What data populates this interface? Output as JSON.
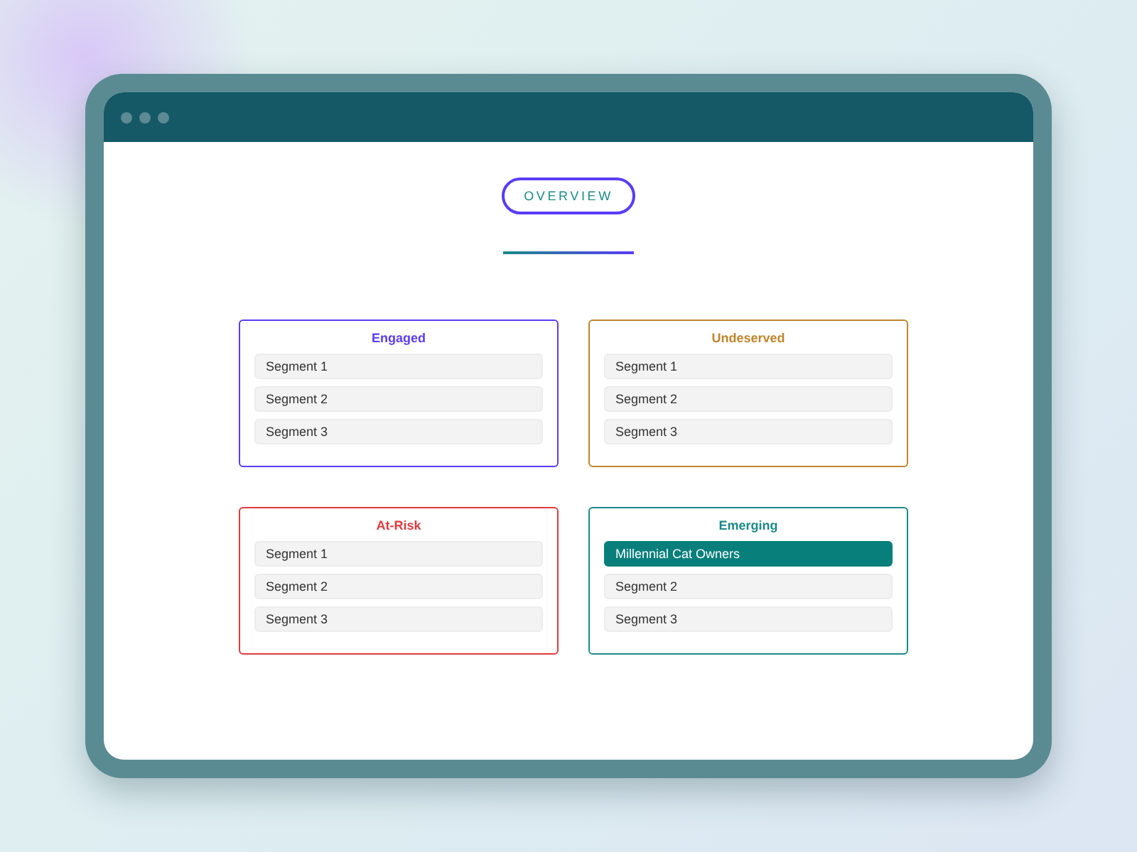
{
  "header": {
    "label": "OVERVIEW"
  },
  "cards": [
    {
      "title": "Engaged",
      "color": "#5b3cf5",
      "segments": [
        {
          "label": "Segment 1",
          "selected": false
        },
        {
          "label": "Segment 2",
          "selected": false
        },
        {
          "label": "Segment 3",
          "selected": false
        }
      ]
    },
    {
      "title": "Undeserved",
      "color": "#c0852c",
      "segments": [
        {
          "label": "Segment 1",
          "selected": false
        },
        {
          "label": "Segment 2",
          "selected": false
        },
        {
          "label": "Segment 3",
          "selected": false
        }
      ]
    },
    {
      "title": "At-Risk",
      "color": "#e03a3e",
      "segments": [
        {
          "label": "Segment 1",
          "selected": false
        },
        {
          "label": "Segment 2",
          "selected": false
        },
        {
          "label": "Segment 3",
          "selected": false
        }
      ]
    },
    {
      "title": "Emerging",
      "color": "#1a8a86",
      "segments": [
        {
          "label": "Millennial Cat Owners",
          "selected": true
        },
        {
          "label": "Segment 2",
          "selected": false
        },
        {
          "label": "Segment 3",
          "selected": false
        }
      ]
    }
  ]
}
